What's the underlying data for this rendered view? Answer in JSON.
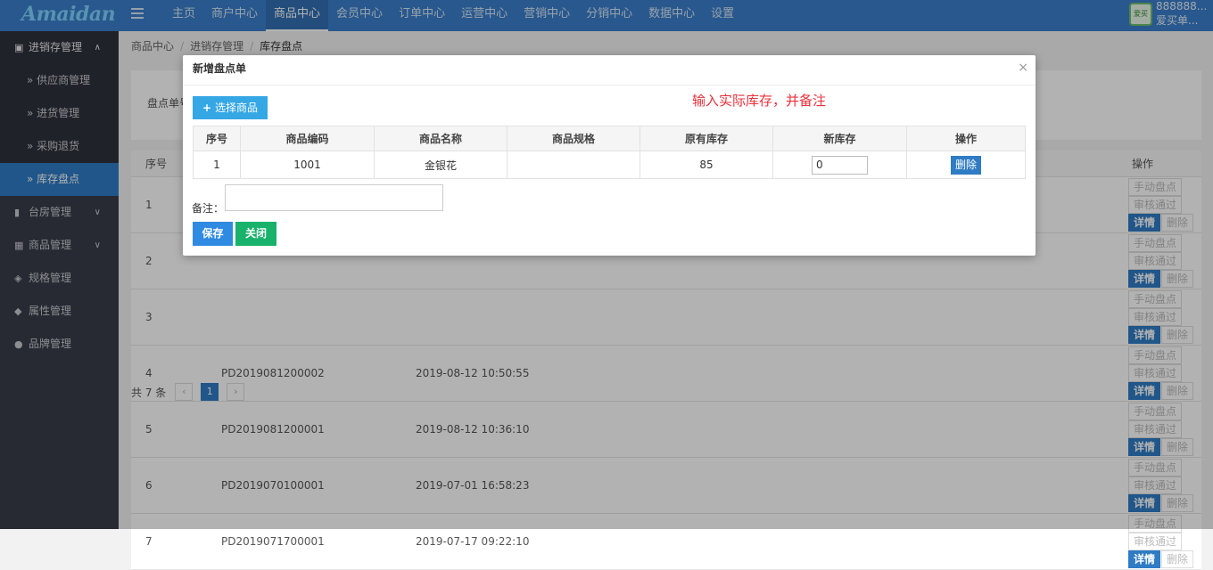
{
  "header": {
    "logo": "Amaidan",
    "nav": [
      "主页",
      "商户中心",
      "商品中心",
      "会员中心",
      "订单中心",
      "运营中心",
      "营销中心",
      "分销中心",
      "数据中心",
      "设置"
    ],
    "active_nav": "商品中心",
    "avatar_text": "爱买",
    "user_line1": "888888...",
    "user_line2": "爱买单..."
  },
  "sidebar": {
    "groups": [
      {
        "label": "进销存管理",
        "icon": "map-icon",
        "open": true,
        "items": [
          "供应商管理",
          "进货管理",
          "采购退货",
          "库存盘点"
        ]
      },
      {
        "label": "台房管理",
        "icon": "bookmark-icon"
      },
      {
        "label": "商品管理",
        "icon": "grid-icon"
      },
      {
        "label": "规格管理",
        "icon": "cubes-icon"
      },
      {
        "label": "属性管理",
        "icon": "cube-icon"
      },
      {
        "label": "品牌管理",
        "icon": "tags-icon"
      }
    ],
    "active_item": "库存盘点"
  },
  "breadcrumb": [
    "商品中心",
    "进销存管理",
    "库存盘点"
  ],
  "filter": {
    "label": "盘点单号"
  },
  "list": {
    "headers": {
      "index": "序号",
      "ops": "操作"
    },
    "rows": [
      {
        "index": "1",
        "no": "",
        "time": ""
      },
      {
        "index": "2",
        "no": "",
        "time": ""
      },
      {
        "index": "3",
        "no": "",
        "time": ""
      },
      {
        "index": "4",
        "no": "PD2019081200002",
        "time": "2019-08-12 10:50:55"
      },
      {
        "index": "5",
        "no": "PD2019081200001",
        "time": "2019-08-12 10:36:10"
      },
      {
        "index": "6",
        "no": "PD2019070100001",
        "time": "2019-07-01 16:58:23"
      },
      {
        "index": "7",
        "no": "PD2019071700001",
        "time": "2019-07-17 09:22:10"
      }
    ],
    "ops": {
      "manual": "手动盘点",
      "approve": "审核通过",
      "detail": "详情",
      "delete": "删除"
    }
  },
  "pager": {
    "total": "共 7 条",
    "current": "1"
  },
  "modal": {
    "title": "新增盘点单",
    "choose_button": "选择商品",
    "hint": "输入实际库存，并备注",
    "columns": [
      "序号",
      "商品编码",
      "商品名称",
      "商品规格",
      "原有库存",
      "新库存",
      "操作"
    ],
    "items": [
      {
        "index": "1",
        "code": "1001",
        "name": "金银花",
        "spec": "",
        "old_stock": "85",
        "new_stock": "0",
        "action": "删除"
      }
    ],
    "remark_label": "备注：",
    "save": "保存",
    "close": "关闭"
  }
}
